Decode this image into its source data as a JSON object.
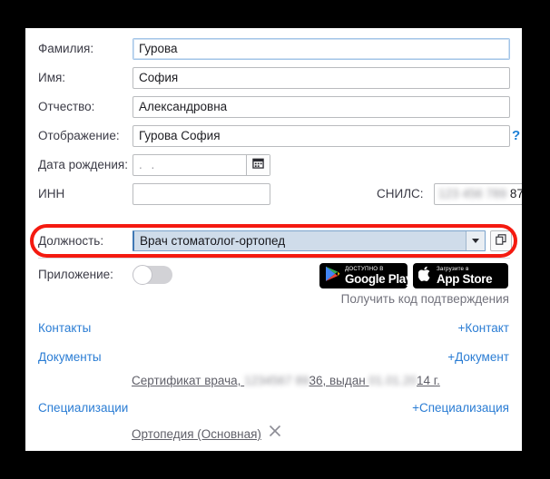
{
  "form": {
    "rows": [
      {
        "label": "Фамилия:",
        "value": "Гурова",
        "focused": true
      },
      {
        "label": "Имя:",
        "value": "София",
        "focused": false
      },
      {
        "label": "Отчество:",
        "value": "Александровна",
        "focused": false
      },
      {
        "label": "Отображение:",
        "value": "Гурова София",
        "focused": false
      }
    ],
    "birthdate": {
      "label": "Дата рождения:",
      "value": ".   .",
      "calendar_icon": "calendar-icon"
    },
    "inn": {
      "label": "ИНН",
      "value": ""
    },
    "snils": {
      "label": "СНИЛС:",
      "blurred_value": "123 456 789",
      "visible_value": "87"
    },
    "display_hint": "?",
    "position": {
      "label": "Должность:",
      "value": "Врач стоматолог-ортопед",
      "dropdown_icon": "chevron-down-icon",
      "copy_icon": "copy-icon"
    },
    "app": {
      "label": "Приложение:",
      "toggle_state": "off"
    }
  },
  "badges": {
    "google_play": {
      "top": "ДОСТУПНО В",
      "main": "Google Play",
      "icon": "google-play-icon"
    },
    "app_store": {
      "top": "Загрузите в",
      "main": "App Store",
      "icon": "apple-icon"
    }
  },
  "get_code": "Получить код подтверждения",
  "sections": [
    {
      "title": "Контакты",
      "add": "+Контакт"
    },
    {
      "title": "Документы",
      "add": "+Документ"
    },
    {
      "title": "Специализации",
      "add": "+Специализация"
    }
  ],
  "document_item": {
    "prefix": "Сертификат врача,",
    "blur1": "1234567 89",
    "mid": "36, выдан",
    "blur2": "01.01.20",
    "suffix": "14 г."
  },
  "specialization_item": {
    "label": "Ортопедия (Основная)",
    "remove_icon": "close-icon"
  },
  "highlight": {
    "color": "#f41a10",
    "target": "position-row"
  }
}
